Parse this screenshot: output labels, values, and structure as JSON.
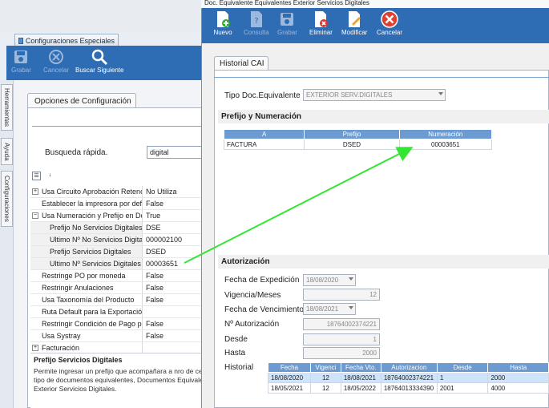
{
  "background_window": {
    "tab_label": "Configuraciones Especiales",
    "toolbar": {
      "save": "Grabar",
      "cancel": "Cancelar",
      "search_next": "Buscar Siguiente"
    },
    "side_tabs": [
      "Herramientas",
      "Ayuda",
      "Configuraciones"
    ],
    "options_tab": "Opciones de Configuración",
    "quick_search_label": "Busqueda rápida.",
    "quick_search_value": "digital",
    "properties": [
      {
        "name": "Usa Circuito Aprobación Retencio",
        "value": "No Utiliza",
        "expander": "+",
        "sub": false
      },
      {
        "name": "Establecer la impresora por defec",
        "value": "False",
        "expander": "",
        "sub": false
      },
      {
        "name": "Usa Numeración y Prefijo en Docu",
        "value": "True",
        "expander": "−",
        "sub": false
      },
      {
        "name": "Prefijo No Servicios Digitales",
        "value": "DSE",
        "expander": "",
        "sub": true
      },
      {
        "name": "Ultimo Nº No Servicios Digitales",
        "value": "000002100",
        "expander": "",
        "sub": true
      },
      {
        "name": "Prefijo Servicios Digitales",
        "value": "DSED",
        "expander": "",
        "sub": true
      },
      {
        "name": "Ultimo Nº Servicios Digitales",
        "value": "00003651",
        "expander": "",
        "sub": true
      },
      {
        "name": "Restringe PO por moneda",
        "value": "False",
        "expander": "",
        "sub": false
      },
      {
        "name": "Restringir Anulaciones",
        "value": "False",
        "expander": "",
        "sub": false
      },
      {
        "name": "Usa Taxonomía del Producto",
        "value": "False",
        "expander": "",
        "sub": false
      },
      {
        "name": "Ruta Default para la Exportación d",
        "value": "",
        "expander": "",
        "sub": false
      },
      {
        "name": "Restringir Condición de Pago para",
        "value": "False",
        "expander": "",
        "sub": false
      },
      {
        "name": "Usa Systray",
        "value": "False",
        "expander": "",
        "sub": false
      },
      {
        "name": "Facturación",
        "value": "",
        "expander": "+",
        "sub": false
      }
    ],
    "description": {
      "title": "Prefijo Servicios Digitales",
      "text": "Permite ingresar un prefijo que acompañara a nro de ce tipo de documentos equivalentes, Documentos Equivale Exterior Servicios Digitales."
    }
  },
  "dialog": {
    "title": "Doc. Equivalente Equivalentes Exterior Servicios Digitales",
    "toolbar": {
      "new": "Nuevo",
      "query": "Consulta",
      "save": "Grabar",
      "delete": "Eliminar",
      "modify": "Modificar",
      "cancel": "Cancelar"
    },
    "tab": "Historial CAI",
    "doc_type_label": "Tipo Doc.Equivalente",
    "doc_type_value": "EXTERIOR SERV.DIGITALES",
    "prefix_section": "Prefijo y Numeración",
    "prefix_table": {
      "headers": [
        "A",
        "Prefijo",
        "Numeración"
      ],
      "rows": [
        [
          "FACTURA",
          "DSED",
          "00003651"
        ]
      ]
    },
    "auth_section": "Autorización",
    "fields": {
      "fecha_expedicion_label": "Fecha de Expedición",
      "fecha_expedicion": "18/08/2020",
      "vigencia_label": "Vigencia/Meses",
      "vigencia": "12",
      "fecha_vencimiento_label": "Fecha de Vencimiento",
      "fecha_vencimiento": "18/08/2021",
      "autorizacion_label": "Nº Autorización",
      "autorizacion": "18764002374221",
      "desde_label": "Desde",
      "desde": "1",
      "hasta_label": "Hasta",
      "hasta": "2000"
    },
    "history_label": "Historial",
    "history_table": {
      "headers": [
        "Fecha",
        "Vigenci",
        "Fecha Vto.",
        "Autorizacion",
        "Desde",
        "Hasta"
      ],
      "rows": [
        [
          "18/08/2020",
          "12",
          "18/08/2021",
          "18764002374221",
          "1",
          "2000"
        ],
        [
          "18/05/2021",
          "12",
          "18/05/2022",
          "18764013334390",
          "2001",
          "4000"
        ]
      ]
    }
  },
  "colors": {
    "toolbar_blue": "#2e6cb3",
    "grid_header": "#6b9bd1",
    "annotation_arrow": "#33e633"
  }
}
